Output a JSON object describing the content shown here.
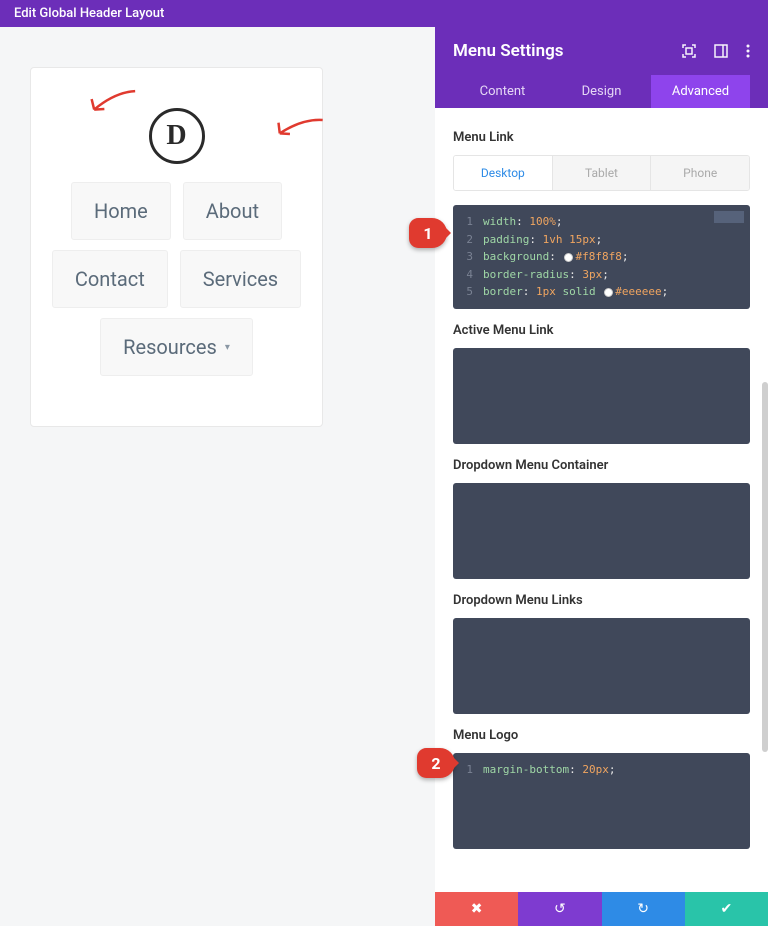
{
  "topbar": {
    "title": "Edit Global Header Layout"
  },
  "preview": {
    "logo_letter": "D",
    "menu": [
      "Home",
      "About",
      "Contact",
      "Services",
      "Resources"
    ]
  },
  "callouts": {
    "one": "1",
    "two": "2"
  },
  "panel": {
    "title": "Menu Settings",
    "tabs": {
      "content": "Content",
      "design": "Design",
      "advanced": "Advanced"
    },
    "sections": {
      "menu_link": "Menu Link",
      "active_menu_link": "Active Menu Link",
      "dropdown_container": "Dropdown Menu Container",
      "dropdown_links": "Dropdown Menu Links",
      "menu_logo": "Menu Logo"
    },
    "devices": {
      "desktop": "Desktop",
      "tablet": "Tablet",
      "phone": "Phone"
    },
    "css_menu_link": {
      "l1": {
        "prop": "width",
        "val": "100%"
      },
      "l2": {
        "prop": "padding",
        "val": "1vh 15px"
      },
      "l3": {
        "prop": "background",
        "val": "#f8f8f8"
      },
      "l4": {
        "prop": "border-radius",
        "val": "3px"
      },
      "l5": {
        "prop": "border",
        "val1": "1px",
        "val2": "solid",
        "val3": "#eeeeee"
      }
    },
    "css_menu_logo": {
      "l1": {
        "prop": "margin-bottom",
        "val": "20px"
      }
    }
  }
}
